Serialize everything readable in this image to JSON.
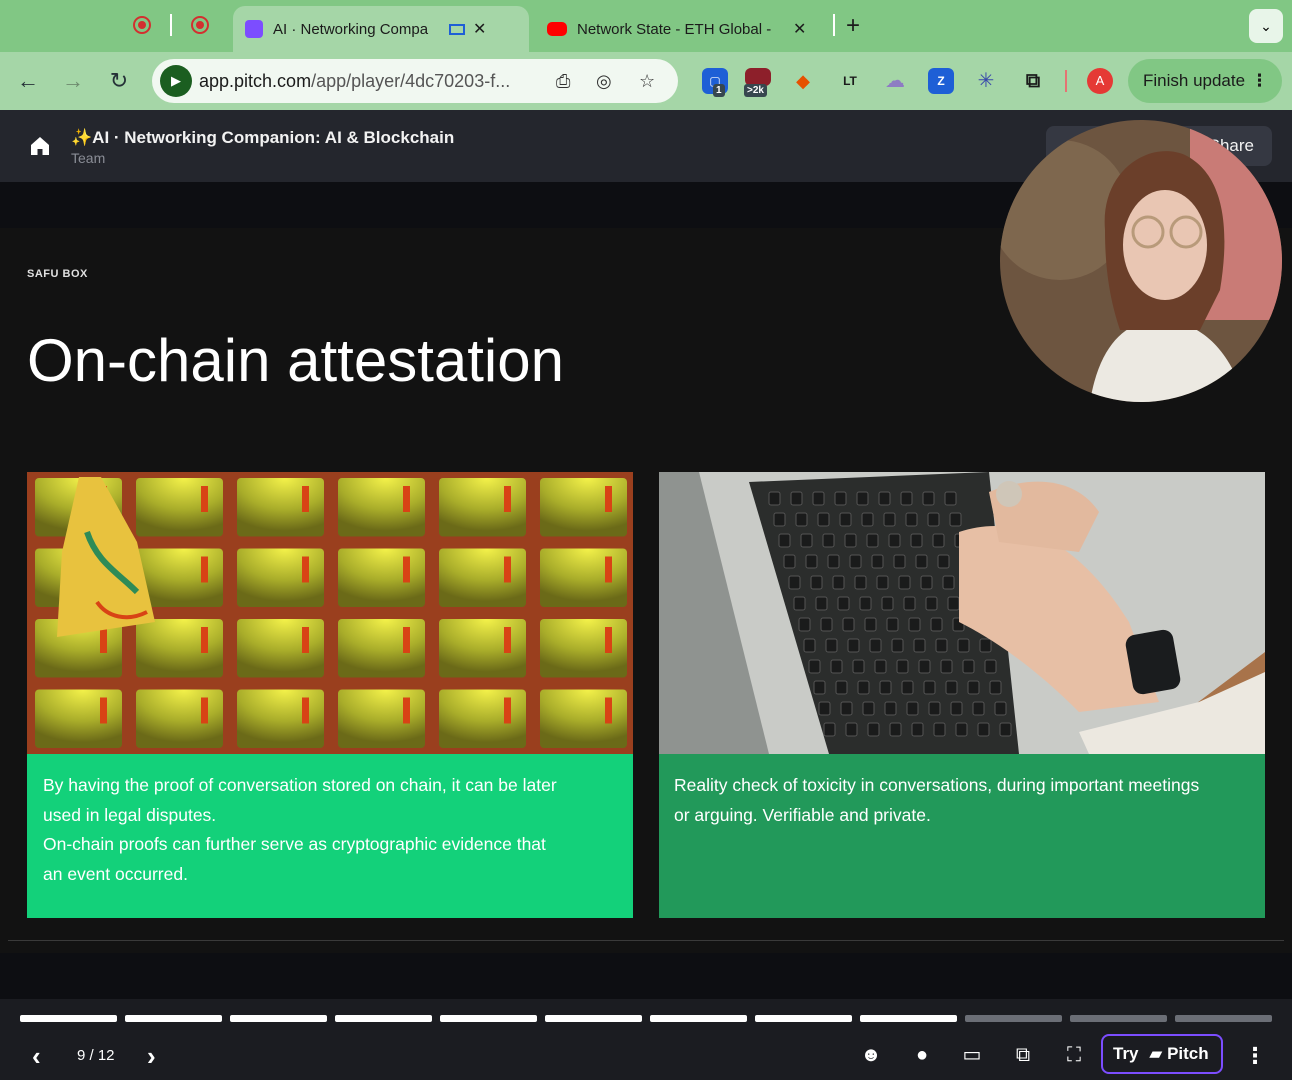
{
  "browser": {
    "tabs": [
      {
        "label": "AI · Networking Compa",
        "favicon_color": "#7c4dff",
        "active": true
      },
      {
        "label": "Network State - ETH Global - ",
        "favicon_color": "#ff0000",
        "active": false
      }
    ],
    "tab_close": "✕",
    "new_tab": "+",
    "url_host": "app.pitch.com",
    "url_path": "/app/player/4dc70203-f...",
    "extension_badges": {
      "first": "1",
      "second": ">2k"
    },
    "extension_labels": {
      "lt": "LT"
    },
    "profile_initial": "A",
    "finish_update": "Finish update"
  },
  "app": {
    "doc_title": "✨AI · Networking Companion: AI & Blockchain",
    "doc_subtitle": "Team",
    "share_label": "Share"
  },
  "slide": {
    "eyebrow": "SAFU BOX",
    "heading": "On-chain attestation",
    "cards": [
      {
        "text_lines": [
          "By having the proof of conversation stored on chain, it can be later",
          "used in legal disputes.",
          "On-chain proofs can further serve as cryptographic evidence that",
          "an event occurred."
        ],
        "photo_icon": "locker-wall-photo"
      },
      {
        "text_lines": [
          "Reality check of toxicity in conversations, during important meetings",
          "or arguing. Verifiable and private."
        ],
        "photo_icon": "laptop-typing-photo"
      }
    ]
  },
  "player": {
    "current_page": 9,
    "total_pages": 12,
    "page_label": "9 / 12",
    "try_label": "Try",
    "brand_label": "Pitch",
    "colors": {
      "done": "#ffffff",
      "todo": "#6b6e76",
      "accent": "#7c4dff"
    }
  }
}
